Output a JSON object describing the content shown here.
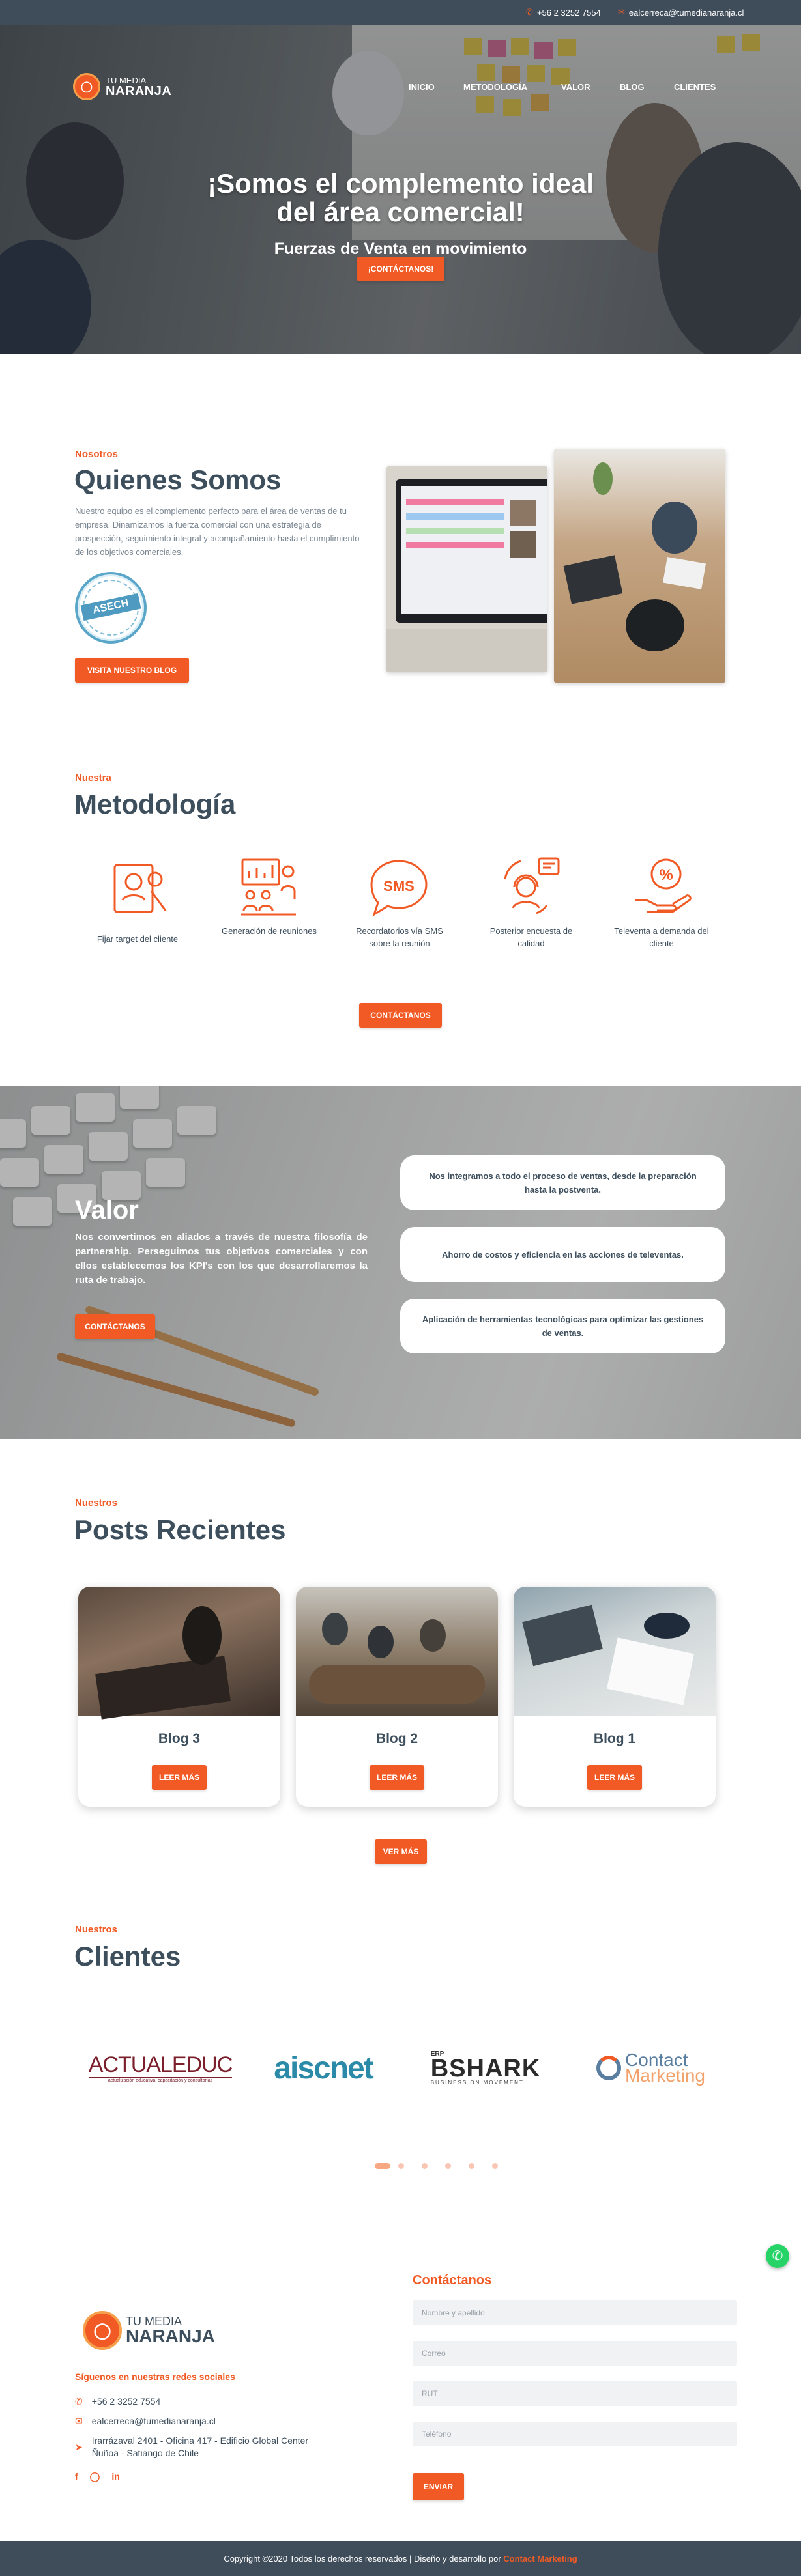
{
  "topbar": {
    "phone": "+56 2 3252 7554",
    "email": "ealcerreca@tumedianaranja.cl"
  },
  "brand": {
    "line1": "TU MEDIA",
    "line2": "NARANJA"
  },
  "nav": [
    "INICIO",
    "METODOLOGÍA",
    "VALOR",
    "BLOG",
    "CLIENTES"
  ],
  "hero": {
    "title_line1": "¡Somos el complemento ideal",
    "title_line2": "del área comercial!",
    "subtitle": "Fuerzas de Venta en movimiento",
    "cta": "¡CONTÁCTANOS!"
  },
  "quienes": {
    "eyebrow": "Nosotros",
    "title": "Quienes Somos",
    "text": "Nuestro equipo es el complemento perfecto para el área de ventas de tu empresa. Dinamizamos la fuerza comercial con una estrategia de prospección, seguimiento integral y acompañamiento hasta el cumplimiento de los objetivos comerciales.",
    "badge_text": "ASECH",
    "button": "VISITA NUESTRO BLOG"
  },
  "metodologia": {
    "eyebrow": "Nuestra",
    "title": "Metodología",
    "items": [
      {
        "label": "Fijar target del cliente",
        "icon": "target-profile-icon"
      },
      {
        "label": "Generación de reuniones",
        "icon": "meeting-presentation-icon"
      },
      {
        "label": "Recordatorios vía SMS sobre la reunión",
        "icon": "sms-bubble-icon",
        "icon_text": "SMS"
      },
      {
        "label": "Posterior encuesta de calidad",
        "icon": "survey-headset-icon"
      },
      {
        "label": "Televenta a demanda del cliente",
        "icon": "percent-hand-icon",
        "icon_text": "%"
      }
    ],
    "button": "CONTÁCTANOS"
  },
  "valor": {
    "title": "Valor",
    "text": "Nos convertimos en aliados a través de nuestra filosofía de partnership. Perseguimos tus objetivos comerciales y con ellos establecemos los KPI's con los que desarrollaremos la ruta de trabajo.",
    "button": "CONTÁCTANOS",
    "cards": [
      "Nos integramos a todo el proceso de ventas, desde la preparación hasta la postventa.",
      "Ahorro de costos y eficiencia en las acciones de televentas.",
      "Aplicación de herramientas tecnológicas para optimizar las gestiones de ventas."
    ]
  },
  "posts": {
    "eyebrow": "Nuestros",
    "title": "Posts Recientes",
    "items": [
      {
        "title": "Blog 3",
        "button": "LEER MÁS"
      },
      {
        "title": "Blog 2",
        "button": "LEER MÁS"
      },
      {
        "title": "Blog 1",
        "button": "LEER MÁS"
      }
    ],
    "more": "VER MÁS"
  },
  "clientes": {
    "eyebrow": "Nuestros",
    "title": "Clientes",
    "logos": [
      {
        "name": "ACTUALEDUC",
        "tagline": "actualización educativa, capacitación y consultorías"
      },
      {
        "name": "aiscnet"
      },
      {
        "name": "BSHARK",
        "prefix": "ERP",
        "tagline": "BUSINESS ON MOVEMENT"
      },
      {
        "name_line1": "Contact",
        "name_line2": "Marketing"
      }
    ],
    "active_slide": 1,
    "slide_count": 6
  },
  "footer": {
    "brand_line1": "TU MEDIA",
    "brand_line2": "NARANJA",
    "social_title": "Síguenos en nuestras redes sociales",
    "phone": "+56 2 3252 7554",
    "email": "ealcerreca@tumedianaranja.cl",
    "address_line1": "Irarrázaval 2401 - Oficina 417 - Edificio Global Center",
    "address_line2": "Ñuñoa - Satiango de Chile",
    "contact_title": "Contáctanos",
    "fields": [
      "Nombre y apellido",
      "Correo",
      "RUT",
      "Teléfono"
    ],
    "submit": "ENVIAR"
  },
  "copyright": {
    "text": "Copyright ©2020 Todos los derechos reservados | Diseño y desarrollo por",
    "link": "Contact Marketing"
  },
  "colors": {
    "accent": "#f15a24",
    "dark": "#3f4d5b",
    "heading": "#3d4e5c",
    "whatsapp": "#25d366"
  }
}
